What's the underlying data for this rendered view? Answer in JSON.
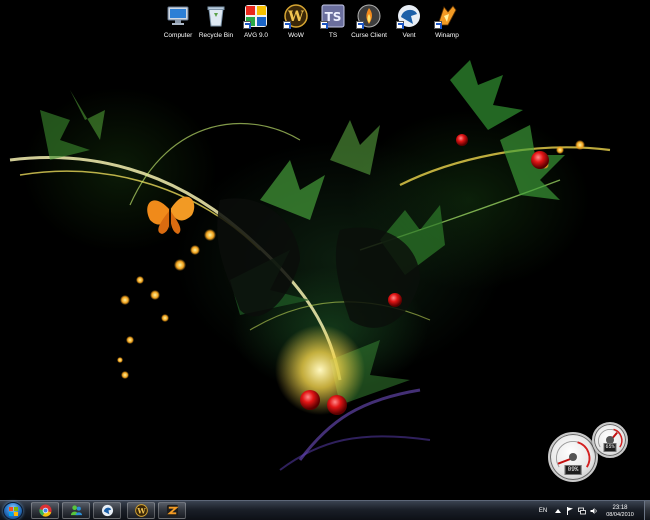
{
  "desktop": {
    "icons": [
      {
        "label": "Computer",
        "icon": "computer-icon"
      },
      {
        "label": "Recycle Bin",
        "icon": "recycle-bin-icon"
      },
      {
        "label": "AVG 9.0",
        "icon": "avg-icon"
      },
      {
        "label": "WoW",
        "icon": "wow-icon"
      },
      {
        "label": "TS",
        "icon": "teamspeak-icon"
      },
      {
        "label": "Curse Client",
        "icon": "curse-client-icon"
      },
      {
        "label": "Vent",
        "icon": "ventrilo-icon"
      },
      {
        "label": "Winamp",
        "icon": "winamp-icon"
      }
    ]
  },
  "gadget": {
    "name": "cpu-meter",
    "cpu_percent": "09%",
    "memory_percent": "65%",
    "cpu_level": 9,
    "memory_level": 65
  },
  "taskbar": {
    "start_icon": "windows-logo-icon",
    "pinned": [
      {
        "icon": "chrome-icon"
      },
      {
        "icon": "msn-messenger-icon"
      },
      {
        "icon": "ventrilo-icon"
      },
      {
        "icon": "wow-icon"
      },
      {
        "icon": "zune-icon"
      }
    ],
    "tray": {
      "language": "EN",
      "icons": [
        "show-hidden-icons-icon",
        "action-center-flag-icon",
        "network-icon",
        "volume-icon"
      ],
      "time": "23:18",
      "date": "08/04/2010"
    }
  },
  "colors": {
    "taskbar": "#1a1f28",
    "accent": "#2f7fd0",
    "gauge_needle": "#c21010"
  }
}
